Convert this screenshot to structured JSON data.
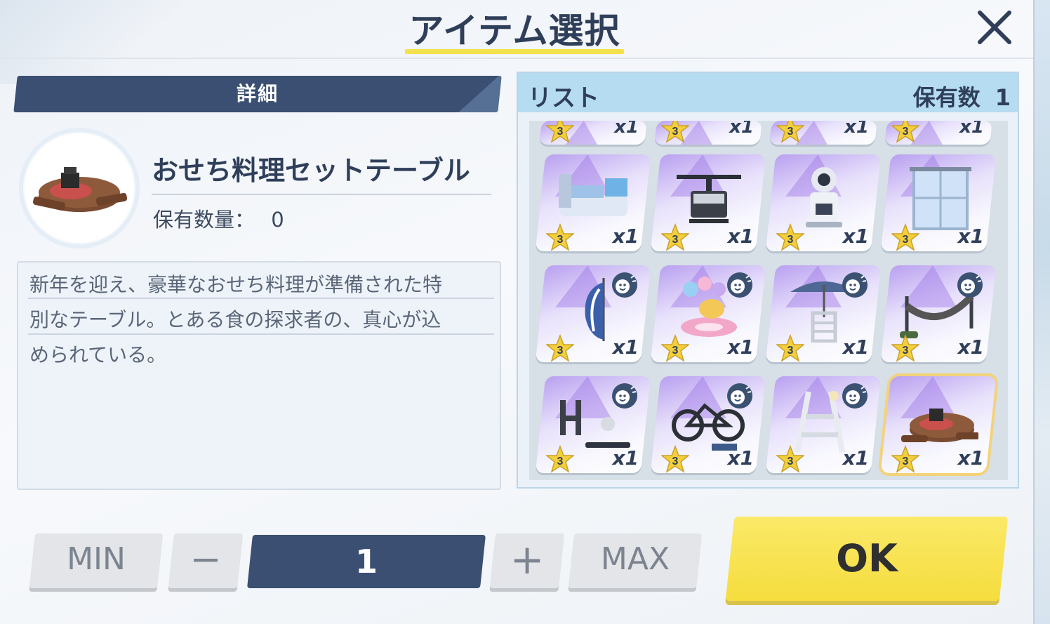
{
  "title": "アイテム選択",
  "detail": {
    "header": "詳細",
    "item_name": "おせち料理セットテーブル",
    "owned_label": "保有数量：",
    "owned_value": "0",
    "description_lines": [
      "新年を迎え、豪華なおせち料理が準備された特",
      "別なテーブル。とある食の探求者の、真心が込",
      "められている。"
    ]
  },
  "list": {
    "title": "リスト",
    "count_label": "保有数",
    "count_value": "1",
    "rows": [
      [
        {
          "icon": "partial-item-icon",
          "rarity": "3",
          "qty": "x1"
        },
        {
          "icon": "partial-item-icon",
          "rarity": "3",
          "qty": "x1"
        },
        {
          "icon": "partial-item-icon",
          "rarity": "3",
          "qty": "x1"
        },
        {
          "icon": "partial-item-icon",
          "rarity": "3",
          "qty": "x1"
        }
      ],
      [
        {
          "icon": "command-desk-icon",
          "rarity": "3",
          "qty": "x1",
          "interaction": false
        },
        {
          "icon": "drone-icon",
          "rarity": "3",
          "qty": "x1",
          "interaction": false
        },
        {
          "icon": "robot-icon",
          "rarity": "3",
          "qty": "x1",
          "interaction": false
        },
        {
          "icon": "window-curtain-icon",
          "rarity": "3",
          "qty": "x1",
          "interaction": false
        }
      ],
      [
        {
          "icon": "beach-flag-icon",
          "rarity": "3",
          "qty": "x1",
          "interaction": true
        },
        {
          "icon": "float-balloons-icon",
          "rarity": "3",
          "qty": "x1",
          "interaction": true
        },
        {
          "icon": "lifeguard-chair-icon",
          "rarity": "3",
          "qty": "x1",
          "interaction": true
        },
        {
          "icon": "hammock-icon",
          "rarity": "3",
          "qty": "x1",
          "interaction": true
        }
      ],
      [
        {
          "icon": "training-set-icon",
          "rarity": "3",
          "qty": "x1",
          "interaction": true
        },
        {
          "icon": "bicycle-icon",
          "rarity": "3",
          "qty": "x1",
          "interaction": true
        },
        {
          "icon": "stepladder-icon",
          "rarity": "3",
          "qty": "x1",
          "interaction": true
        },
        {
          "icon": "osechi-table-icon",
          "rarity": "3",
          "qty": "x1",
          "interaction": false,
          "selected": true
        }
      ]
    ]
  },
  "controls": {
    "min_label": "MIN",
    "minus_label": "−",
    "quantity": "1",
    "plus_label": "+",
    "max_label": "MAX",
    "ok_label": "OK"
  },
  "colors": {
    "navy": "#3a4f72",
    "accent_yellow": "#f5dd3e",
    "list_header": "#b6dcf1",
    "card_purple": "#b9a0f0"
  }
}
